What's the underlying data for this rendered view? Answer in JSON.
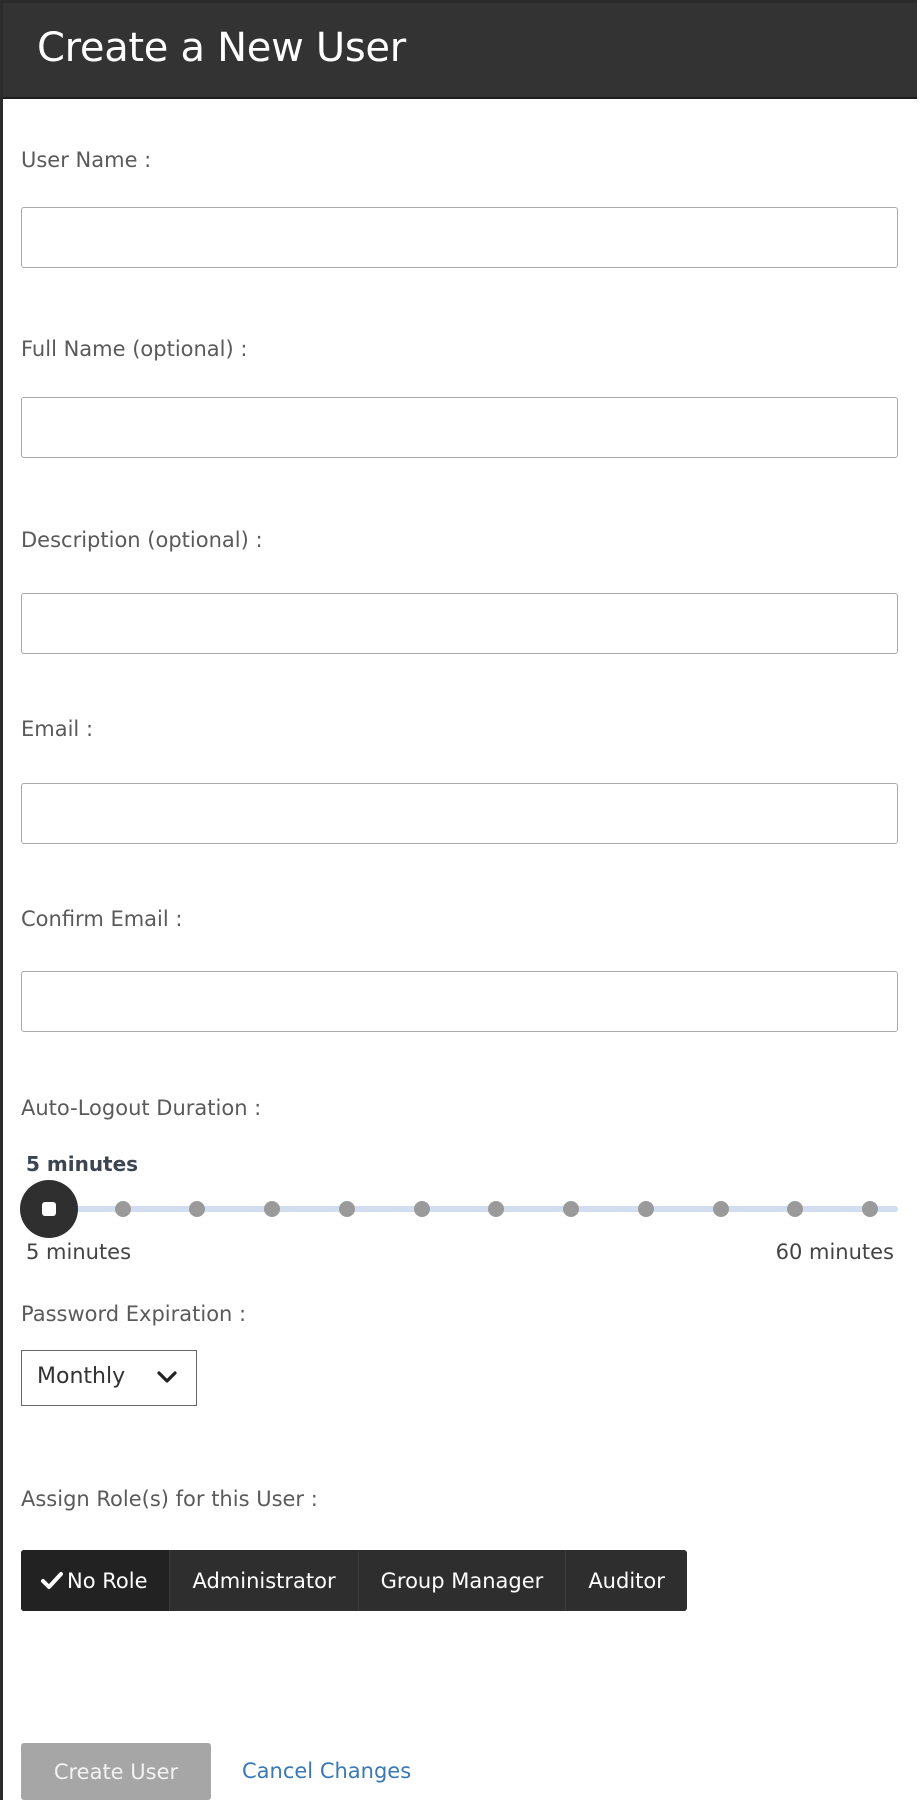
{
  "header": {
    "title": "Create a New User"
  },
  "fields": [
    {
      "label": "User Name :",
      "value": "",
      "placeholder": ""
    },
    {
      "label": "Full Name (optional) :",
      "value": "",
      "placeholder": ""
    },
    {
      "label": "Description (optional) :",
      "value": "",
      "placeholder": ""
    },
    {
      "label": "Email :",
      "value": "",
      "placeholder": ""
    },
    {
      "label": "Confirm Email :",
      "value": "",
      "placeholder": ""
    }
  ],
  "auto_logout": {
    "label": "Auto-Logout Duration :",
    "current_value_label": "5 minutes",
    "min_label": "5 minutes",
    "max_label": "60 minutes",
    "step_count": 12,
    "selected_step": 0
  },
  "password_expiration": {
    "label": "Password Expiration :",
    "selected": "Monthly"
  },
  "roles": {
    "label": "Assign Role(s) for this User :",
    "options": [
      "No Role",
      "Administrator",
      "Group Manager",
      "Auditor"
    ],
    "selected": "No Role"
  },
  "actions": {
    "create_label": "Create User",
    "cancel_label": "Cancel Changes"
  },
  "colors": {
    "header_bg": "#333333",
    "button_disabled": "#a6a6a6",
    "link": "#3a78b5",
    "slider_track": "#d2ddf0"
  }
}
